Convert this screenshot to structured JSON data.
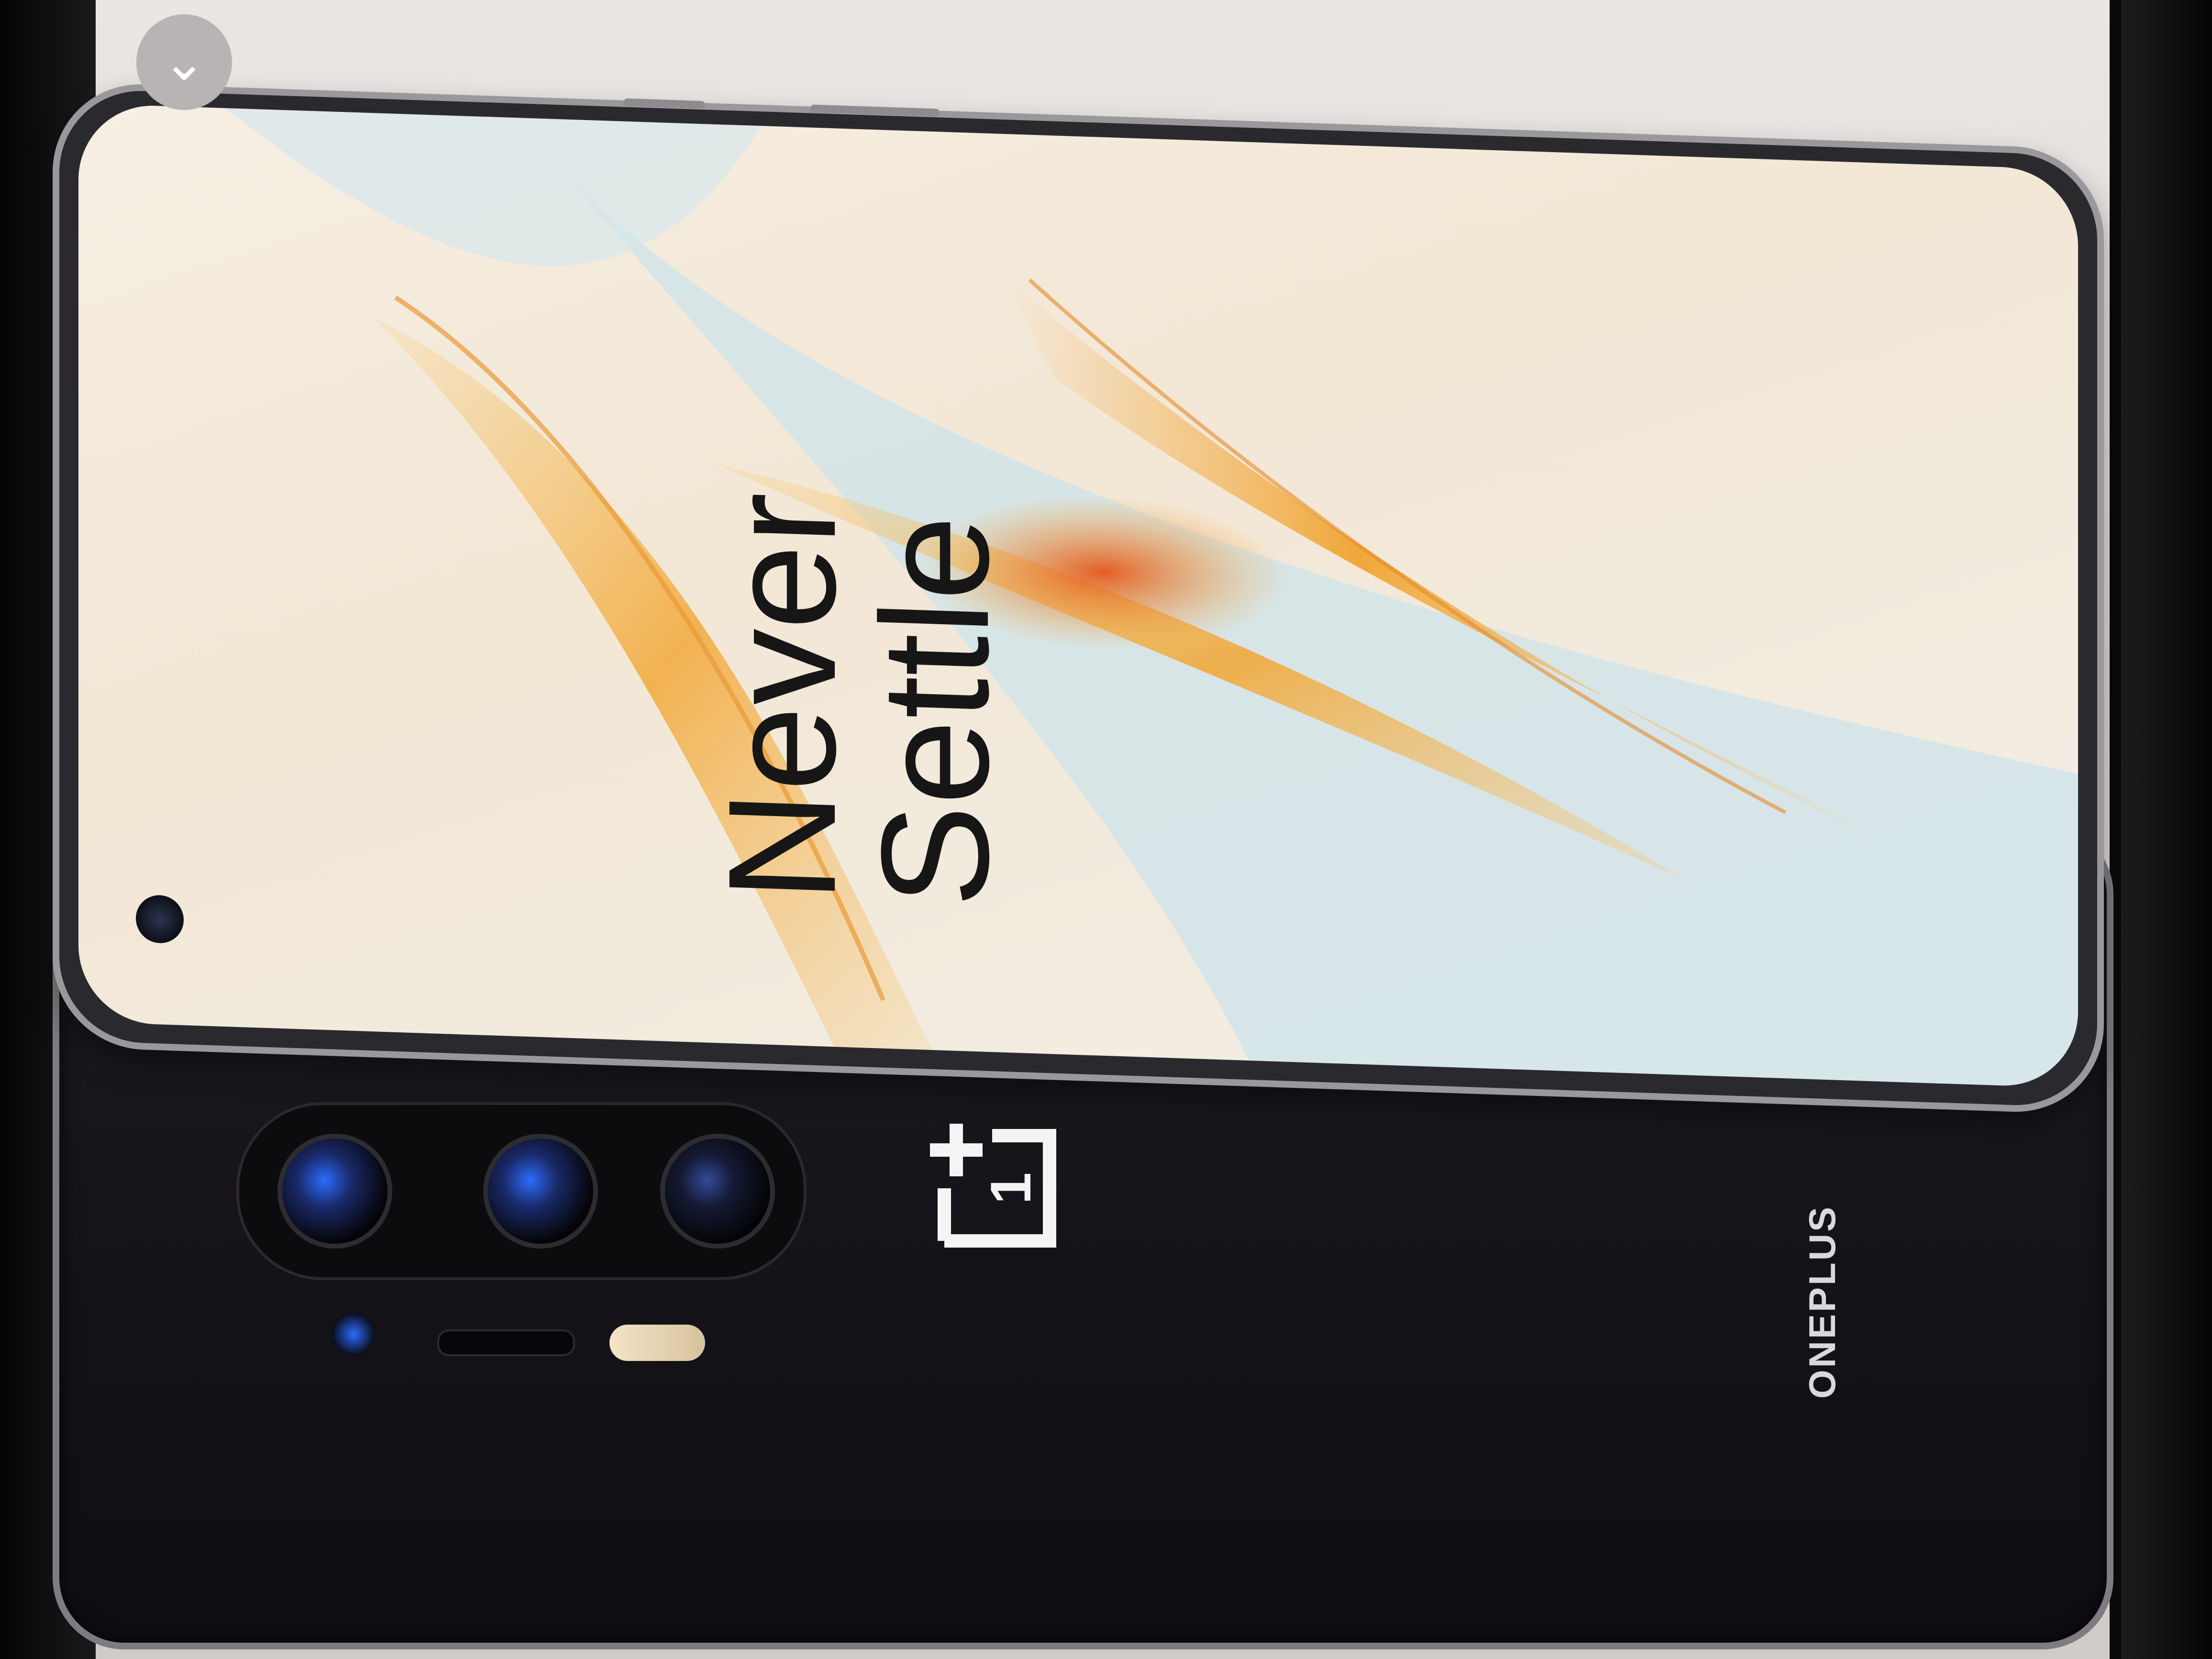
{
  "overlay": {
    "collapse_icon": "chevron-down-icon",
    "collapse_glyph": "⌄"
  },
  "display": {
    "tagline_line1": "Never",
    "tagline_line2": "Settle"
  },
  "phone_back": {
    "brand_wordmark": "ONEPLUS",
    "logo_icon": "oneplus-logo-icon",
    "logo_glyph": "1"
  },
  "colors": {
    "accent_orange": "#f2a531",
    "wallpaper_blue": "#cfe3ea",
    "phone_body": "#141318",
    "lens_blue": "#2b6cff"
  }
}
